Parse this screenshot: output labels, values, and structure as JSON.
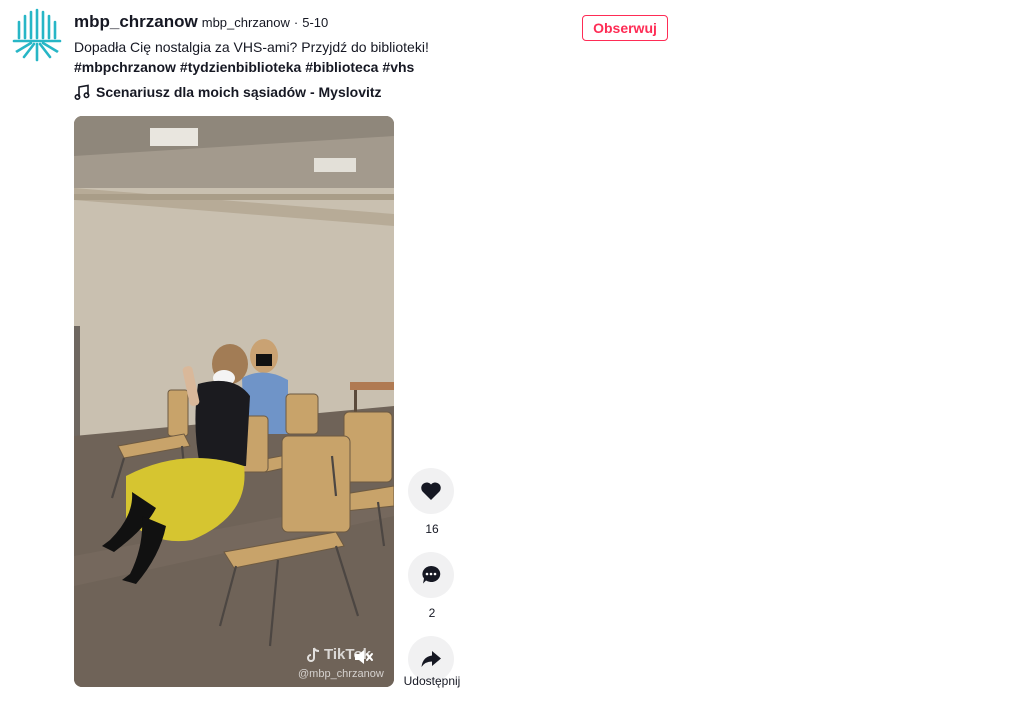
{
  "author": {
    "username": "mbp_chrzanow",
    "nickname": "mbp_chrzanow",
    "separator": "·",
    "date": "5-10"
  },
  "post": {
    "description": "Dopadła Cię nostalgia za VHS-ami? Przyjdź do biblioteki!",
    "hashtags": [
      "#mbpchrzanow",
      "#tydzienbiblioteka",
      "#biblioteca",
      "#vhs"
    ],
    "music": "Scenariusz dla moich sąsiadów - Myslovitz"
  },
  "follow_label": "Obserwuj",
  "video": {
    "watermark_brand": "TikTok",
    "watermark_handle": "@mbp_chrzanow",
    "muted": true
  },
  "actions": {
    "likes": "16",
    "comments": "2",
    "share_label": "Udostępnij"
  },
  "colors": {
    "accent": "#fe2c55",
    "logo": "#27b6c6"
  }
}
